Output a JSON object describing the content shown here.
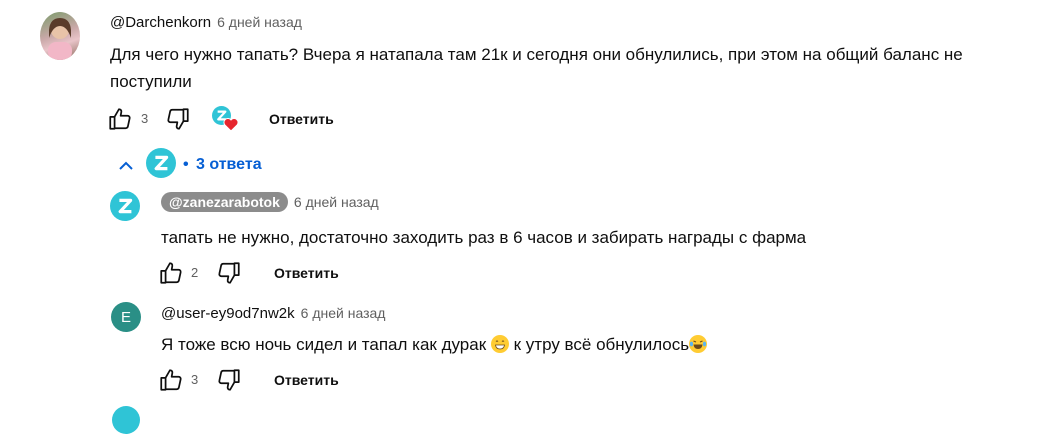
{
  "colors": {
    "brand_z": "#2fc4d6",
    "link": "#065fd4",
    "heart": "#e6262e",
    "chip_bg": "#8c8c8c",
    "e_avatar": "#2a8f86"
  },
  "comment": {
    "author": "@Darchenkorn",
    "time": "6 дней назад",
    "text_line1": "Для чего нужно тапать? Вчера я натапала там 21к и сегодня они обнулились, при этом на общий баланс не",
    "text_line2": "поступили",
    "likes": "3",
    "reply_label": "Ответить"
  },
  "replies_toggle": {
    "dot": "•",
    "label": "3 ответа"
  },
  "replies": [
    {
      "author": "@zanezarabotok",
      "time": "6 дней назад",
      "text": "тапать не нужно, достаточно заходить раз в 6 часов и забирать награды с фарма",
      "likes": "2",
      "reply_label": "Ответить"
    },
    {
      "avatar_letter": "E",
      "author": "@user-ey9od7nw2k",
      "time": "6 дней назад",
      "text_before": "Я тоже всю ночь сидел и тапал как дурак",
      "text_after": " к утру всё обнулилось",
      "likes": "3",
      "reply_label": "Ответить"
    }
  ]
}
